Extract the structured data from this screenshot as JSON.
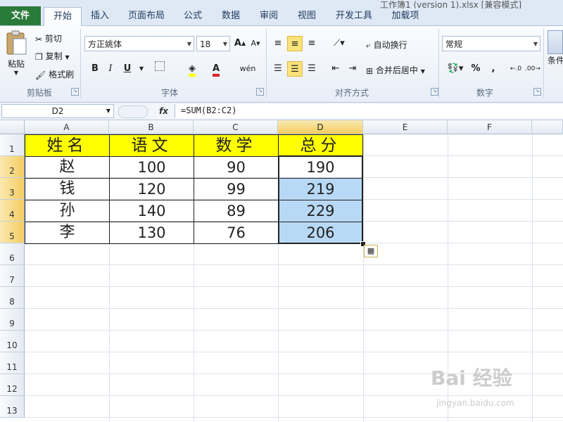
{
  "title": {
    "text": "工作簿1 (version 1).xlsx [兼容模式]"
  },
  "tabs": [
    {
      "label": "文件",
      "kind": "file"
    },
    {
      "label": "开始",
      "kind": "active"
    },
    {
      "label": "插入"
    },
    {
      "label": "页面布局"
    },
    {
      "label": "公式"
    },
    {
      "label": "数据"
    },
    {
      "label": "审阅"
    },
    {
      "label": "视图"
    },
    {
      "label": "开发工具"
    },
    {
      "label": "加载项"
    }
  ],
  "ribbon": {
    "clipboard": {
      "paste": "粘贴",
      "cut": "剪切",
      "copy": "复制",
      "format_painter": "格式刷",
      "group": "剪贴板"
    },
    "font": {
      "family": "方正姚体",
      "size": "18",
      "bold": "B",
      "italic": "I",
      "underline": "U",
      "wen": "wén",
      "group": "字体"
    },
    "alignment": {
      "wrap": "自动换行",
      "merge": "合并后居中",
      "group": "对齐方式"
    },
    "number": {
      "format": "常规",
      "percent": "%",
      "comma": ",",
      "group": "数字"
    },
    "styles": {
      "cond": "条件"
    }
  },
  "formula_bar": {
    "name_box": "D2",
    "fx": "fx",
    "formula": "=SUM(B2:C2)"
  },
  "grid": {
    "columns": [
      "A",
      "B",
      "C",
      "D",
      "E",
      "F"
    ],
    "rows": [
      "1",
      "2",
      "3",
      "4",
      "5",
      "6",
      "7",
      "8",
      "9",
      "10",
      "11",
      "12",
      "13"
    ],
    "header": [
      "姓名",
      "语文",
      "数学",
      "总分"
    ],
    "data": [
      [
        "赵",
        "100",
        "90",
        "190"
      ],
      [
        "钱",
        "120",
        "99",
        "219"
      ],
      [
        "孙",
        "140",
        "89",
        "229"
      ],
      [
        "李",
        "130",
        "76",
        "206"
      ]
    ]
  },
  "watermark": {
    "text": "Bai 经验",
    "sub": "jingyan.baidu.com"
  },
  "colors": {
    "header_fill": "#ffff00",
    "selection_fill": "#b8d9f5",
    "file_tab": "#2a7a3a"
  }
}
